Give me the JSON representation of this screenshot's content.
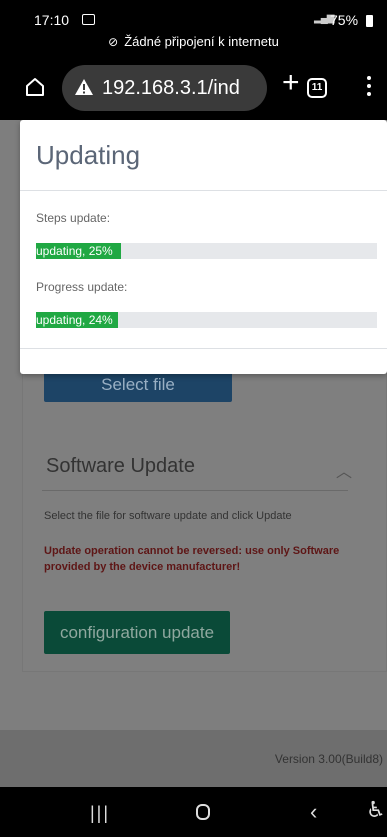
{
  "status_bar": {
    "time": "17:10",
    "battery": "75%",
    "offline_text": "Žádné připojení k internetu"
  },
  "browser": {
    "url": "192.168.3.1/ind",
    "tab_count": "11"
  },
  "modal": {
    "title": "Updating",
    "steps_label": "Steps update:",
    "steps_text": "updating, 25% ",
    "steps_percent": 25,
    "progress_label": "Progress update:",
    "progress_text": "updating, 24%",
    "progress_percent": 24
  },
  "background": {
    "select_file_label": "Select file",
    "software_update_title": "Software Update",
    "software_update_desc": "Select the file for software update and click Update",
    "warning": "Update operation cannot be reversed: use only Software provided by the device manufacturer!",
    "config_button_label": "configuration update",
    "version": "Version 3.00(Build8)"
  },
  "colors": {
    "progress_fill": "#20a843",
    "modal_title": "#5b6677",
    "config_button": "#0a4a38"
  }
}
